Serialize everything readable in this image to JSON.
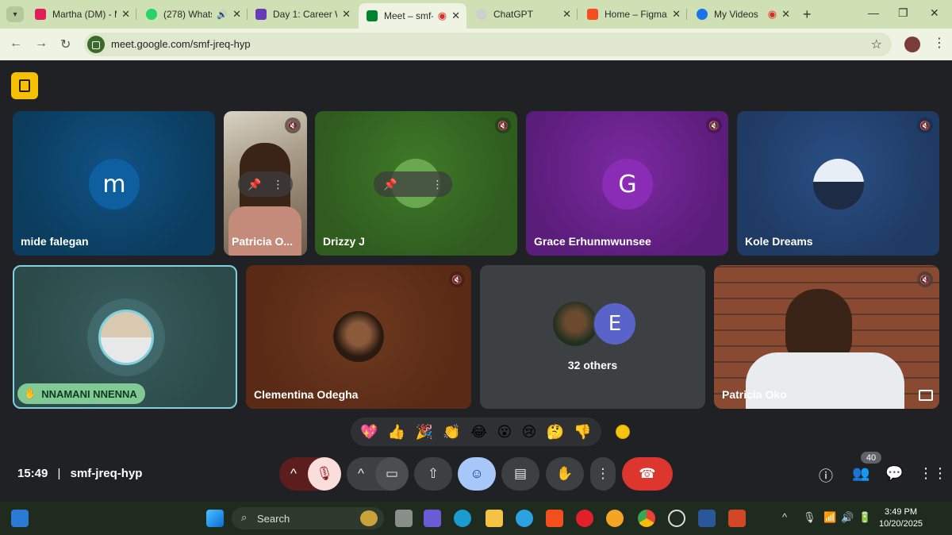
{
  "browser": {
    "tabs": [
      {
        "title": "Martha (DM) - M",
        "fav_color": "#e01e5a"
      },
      {
        "title": "(278) Whats",
        "fav_color": "#25d366"
      },
      {
        "title": "Day 1: Career W",
        "fav_color": "#673ab7"
      },
      {
        "title": "Meet – smf-",
        "fav_color": "#00832d"
      },
      {
        "title": "ChatGPT",
        "fav_color": "#cfcfcf"
      },
      {
        "title": "Home – Figma",
        "fav_color": "#f24e1e"
      },
      {
        "title": "My Videos",
        "fav_color": "#1a73e8"
      }
    ],
    "url": "meet.google.com/smf-jreq-hyp"
  },
  "meeting": {
    "participants": [
      {
        "name": "mide falegan",
        "initial": "m",
        "bg": "#0b3c5d",
        "avatar_bg": "#0d5fa0"
      },
      {
        "name": "Patricia O...",
        "bg": "#6b5a4a"
      },
      {
        "name": "Drizzy J",
        "bg": "#2f5b1f"
      },
      {
        "name": "Grace Erhunmwunsee",
        "initial": "G",
        "bg": "#5b1d7a",
        "avatar_bg": "#8a2cb5"
      },
      {
        "name": "Kole Dreams",
        "bg": "#1f3a63"
      },
      {
        "name": "NNAMANI NNENNA",
        "bg": "#2c4a4a"
      },
      {
        "name": "Clementina Odegha",
        "bg": "#5a2a16"
      },
      {
        "name": "32 others",
        "initial": "E",
        "bg": "#3c4043",
        "avatar_bg": "#5a63c9"
      },
      {
        "name": "Patricia Oko",
        "bg": "#7a3d2a"
      }
    ],
    "reactions": [
      "💖",
      "👍",
      "🎉",
      "👏",
      "😂",
      "😮",
      "😢",
      "🤔",
      "👎"
    ],
    "time": "15:49",
    "separator": "|",
    "code": "smf-jreq-hyp",
    "people_count": "40"
  },
  "taskbar": {
    "search_label": "Search",
    "clock_time": "3:49 PM",
    "clock_date": "10/20/2025"
  }
}
